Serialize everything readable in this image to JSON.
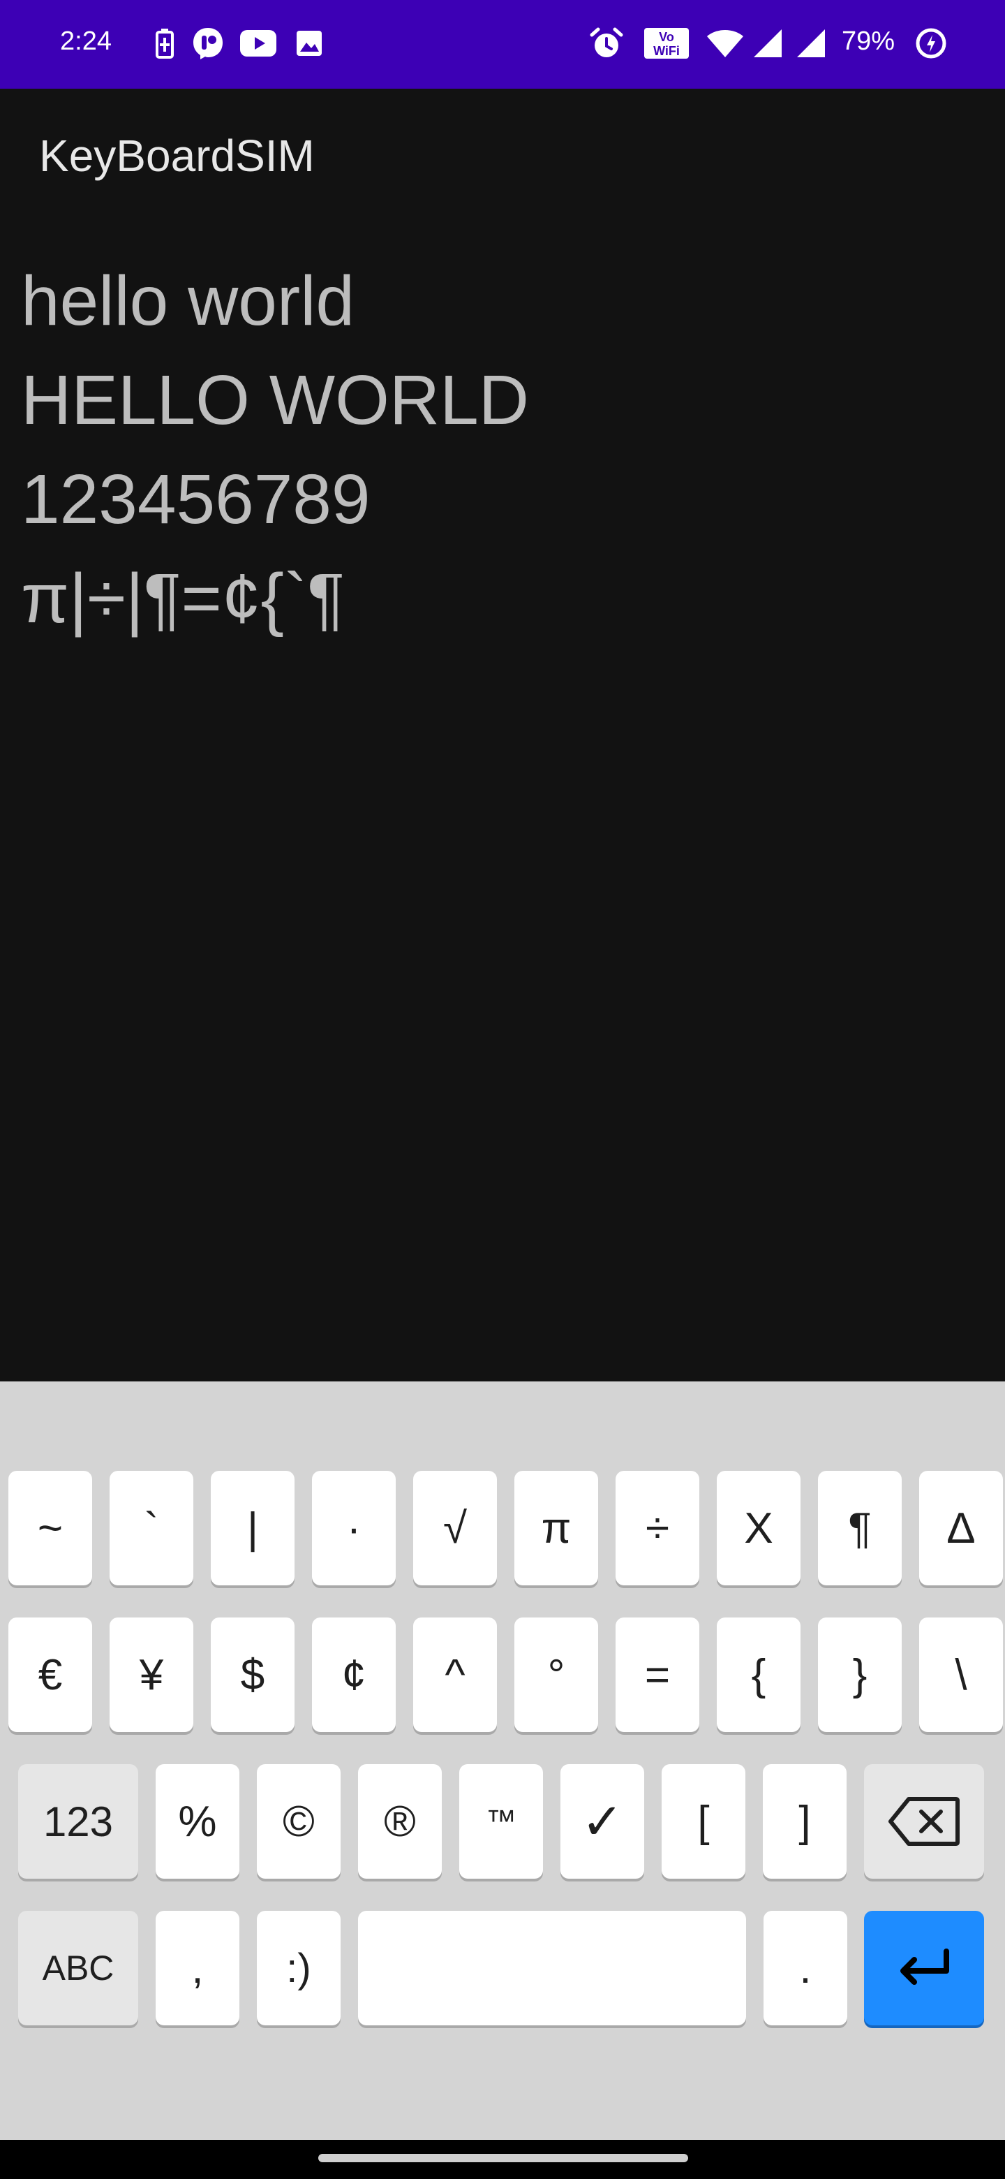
{
  "status_bar": {
    "time": "2:24",
    "battery_percent": "79%",
    "background": "#3d00b5",
    "icons": [
      "battery-saver-icon",
      "messenger-icon",
      "youtube-icon",
      "gallery-icon",
      "alarm-icon",
      "vowifi-icon",
      "wifi-icon",
      "signal-icon",
      "signal-icon-2",
      "battery-icon"
    ],
    "vowifi_label": "Vo WiFi"
  },
  "app": {
    "title": "KeyBoardSIM",
    "lines": [
      "hello world",
      "HELLO WORLD",
      "123456789",
      "π|÷|¶=¢{`¶"
    ]
  },
  "keyboard": {
    "row1": [
      "~",
      "`",
      "|",
      "·",
      "√",
      "π",
      "÷",
      "X",
      "¶",
      "Δ"
    ],
    "row2": [
      "€",
      "¥",
      "$",
      "¢",
      "^",
      "°",
      "=",
      "{",
      "}",
      "\\"
    ],
    "row3": {
      "mode_key": "123",
      "keys": [
        "%",
        "©",
        "®",
        "™",
        "✓",
        "[",
        "]"
      ],
      "backspace_icon": "backspace-icon"
    },
    "row4": {
      "abc_key": "ABC",
      "comma": ",",
      "smiley": ":)",
      "space": "",
      "period": ".",
      "enter_icon": "enter-icon",
      "enter_color": "#1e8cff"
    }
  }
}
